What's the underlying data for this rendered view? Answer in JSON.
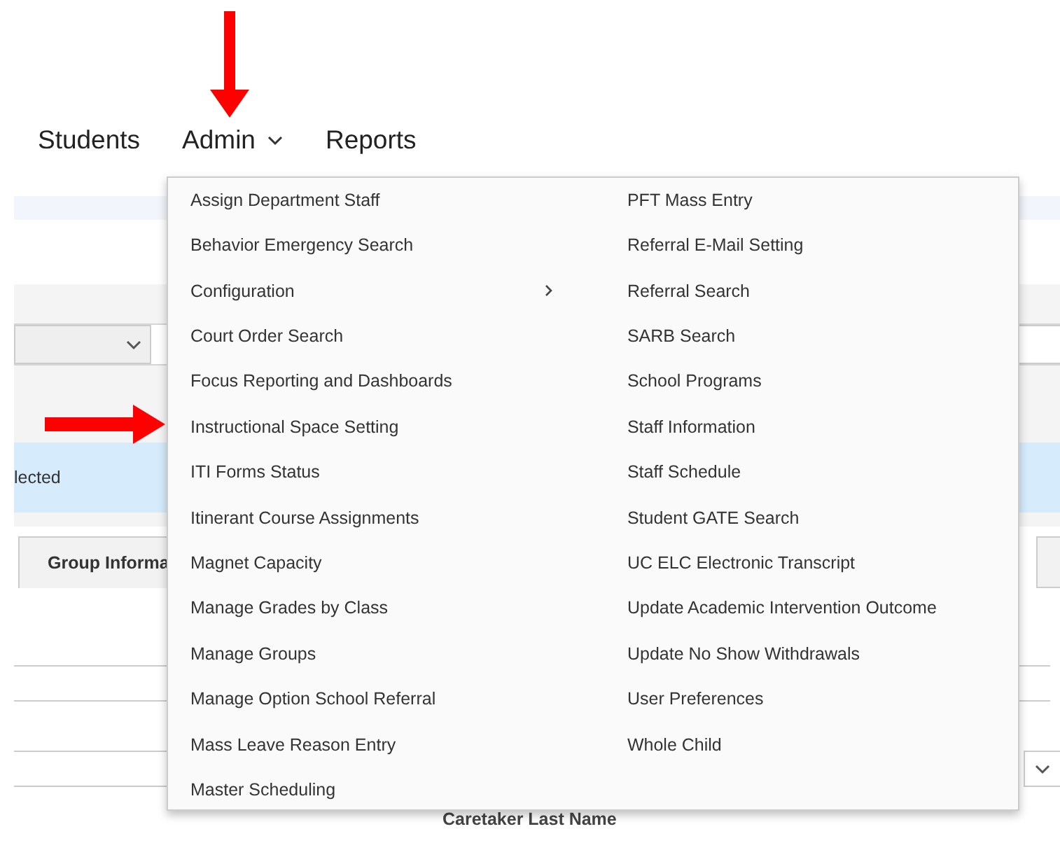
{
  "nav": [
    {
      "label": "Students",
      "dropdown": false
    },
    {
      "label": "Admin",
      "dropdown": true
    },
    {
      "label": "Reports",
      "dropdown": false
    }
  ],
  "selection_banner": "lected",
  "tabs": [
    {
      "label": "Group Informa"
    }
  ],
  "field_label": "Caretaker Last Name",
  "admin_menu": {
    "columns": [
      [
        {
          "label": "Assign Department Staff",
          "submenu": false
        },
        {
          "label": "Behavior Emergency Search",
          "submenu": false
        },
        {
          "label": "Configuration",
          "submenu": true
        },
        {
          "label": "Court Order Search",
          "submenu": false
        },
        {
          "label": "Focus Reporting and Dashboards",
          "submenu": false
        },
        {
          "label": "Instructional Space Setting",
          "submenu": false
        },
        {
          "label": "ITI Forms Status",
          "submenu": false
        },
        {
          "label": "Itinerant Course Assignments",
          "submenu": false
        },
        {
          "label": "Magnet Capacity",
          "submenu": false
        },
        {
          "label": "Manage Grades by Class",
          "submenu": false
        },
        {
          "label": "Manage Groups",
          "submenu": false
        },
        {
          "label": "Manage Option School Referral",
          "submenu": false
        },
        {
          "label": "Mass Leave Reason Entry",
          "submenu": false
        },
        {
          "label": "Master Scheduling",
          "submenu": false
        }
      ],
      [
        {
          "label": "PFT Mass Entry",
          "submenu": false
        },
        {
          "label": "Referral E-Mail Setting",
          "submenu": false
        },
        {
          "label": "Referral Search",
          "submenu": false
        },
        {
          "label": "SARB Search",
          "submenu": false
        },
        {
          "label": "School Programs",
          "submenu": false
        },
        {
          "label": "Staff Information",
          "submenu": false
        },
        {
          "label": "Staff Schedule",
          "submenu": false
        },
        {
          "label": "Student GATE Search",
          "submenu": false
        },
        {
          "label": "UC ELC Electronic Transcript",
          "submenu": false
        },
        {
          "label": "Update Academic Intervention Outcome",
          "submenu": false
        },
        {
          "label": "Update No Show Withdrawals",
          "submenu": false
        },
        {
          "label": "User Preferences",
          "submenu": false
        },
        {
          "label": "Whole Child",
          "submenu": false
        }
      ]
    ]
  },
  "annotations": [
    {
      "kind": "down-arrow"
    },
    {
      "kind": "right-arrow"
    }
  ]
}
